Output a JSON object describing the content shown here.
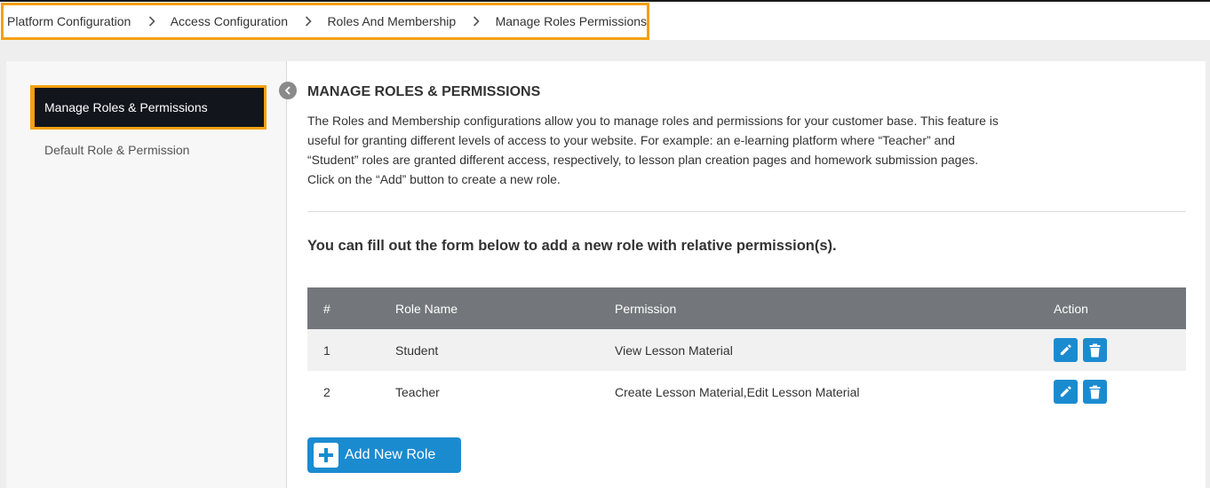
{
  "breadcrumb": {
    "items": [
      {
        "label": "Platform Configuration"
      },
      {
        "label": "Access Configuration"
      },
      {
        "label": "Roles And Membership"
      },
      {
        "label": "Manage Roles Permissions"
      }
    ],
    "separator_icon": "chevron-right-icon"
  },
  "sidebar": {
    "items": [
      {
        "label": "Manage Roles & Permissions",
        "active": true
      },
      {
        "label": "Default Role & Permission",
        "active": false
      }
    ],
    "collapse_icon": "chevron-left-icon"
  },
  "main": {
    "title": "MANAGE ROLES & PERMISSIONS",
    "description": "The Roles and Membership configurations allow you to manage roles and permissions for your customer base. This feature is useful for granting different levels of access to your website. For example: an e-learning platform where “Teacher” and “Student” roles are granted different access, respectively, to lesson plan creation pages and homework submission pages. Click on the “Add” button to create a new role.",
    "form_hint": "You can fill out the form below to add a new role with relative permission(s).",
    "table": {
      "headers": [
        "#",
        "Role Name",
        "Permission",
        "Action"
      ],
      "rows": [
        {
          "num": "1",
          "role": "Student",
          "permission": "View Lesson Material"
        },
        {
          "num": "2",
          "role": "Teacher",
          "permission": "Create Lesson Material,Edit Lesson Material"
        }
      ],
      "action_icons": [
        "pencil-icon",
        "trash-icon"
      ]
    },
    "add_button": {
      "label": "Add New Role",
      "icon": "plus-icon"
    }
  },
  "colors": {
    "accent": "#1b8bd0",
    "highlight_border": "#f5a010",
    "sidebar_active_bg": "#12151c",
    "table_header_bg": "#73777b"
  }
}
